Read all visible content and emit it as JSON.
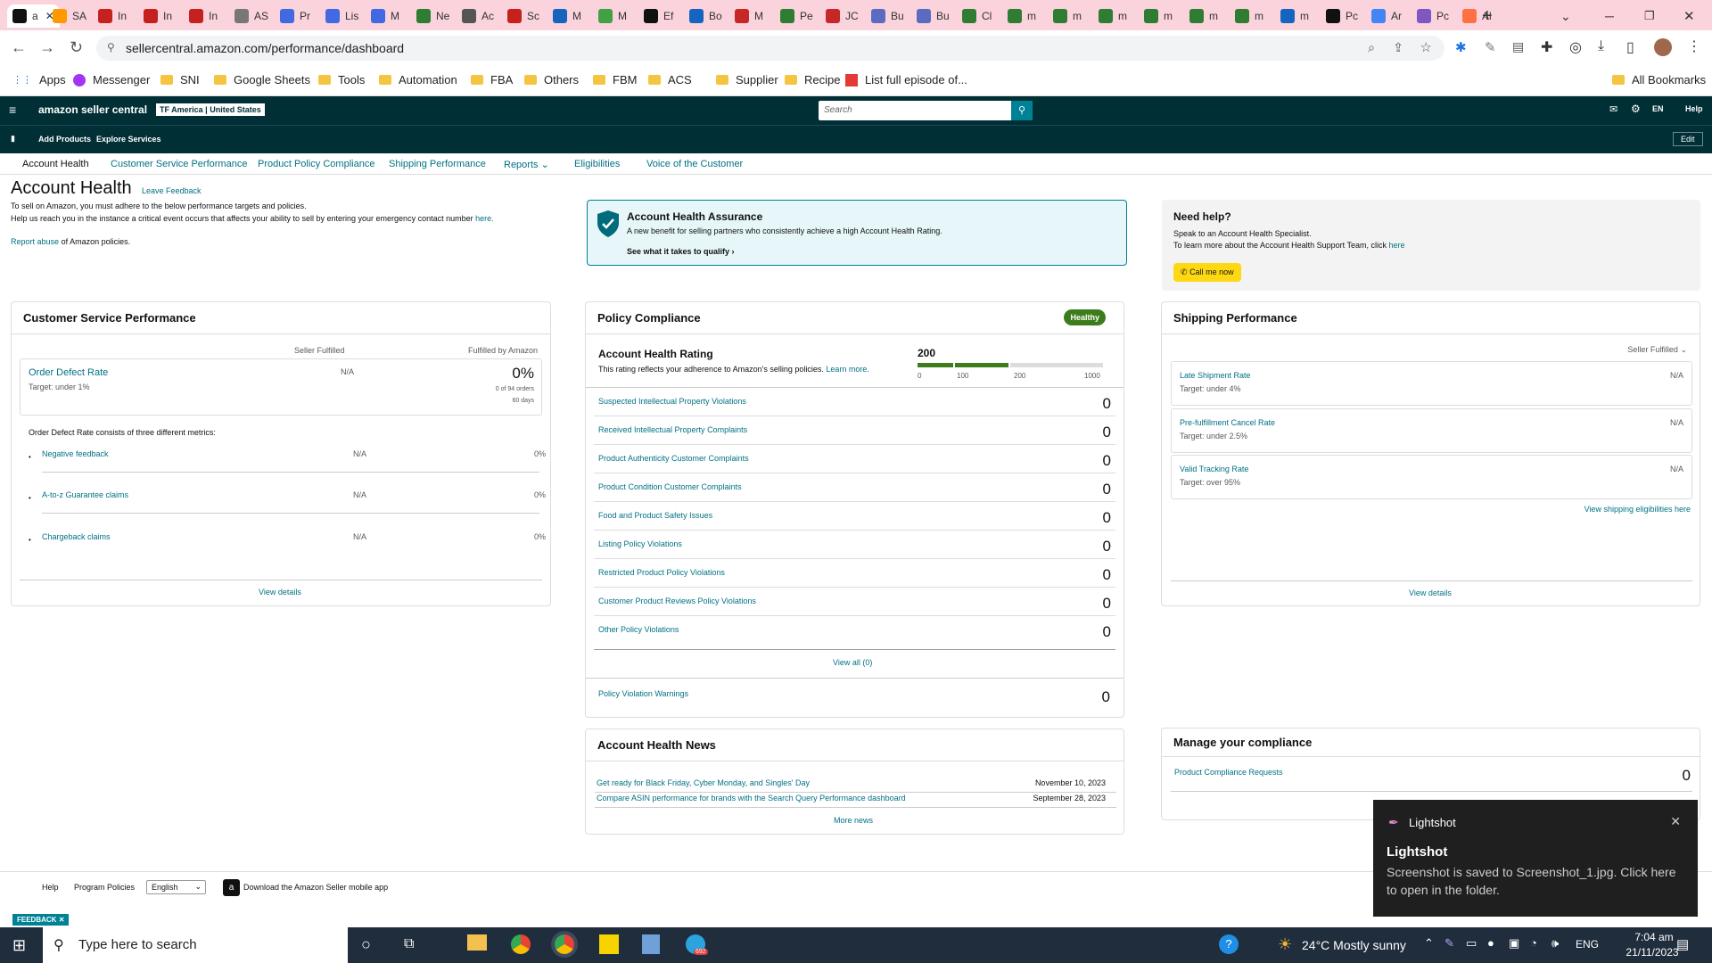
{
  "browser": {
    "tabs": [
      {
        "label": "a",
        "active": true
      },
      {
        "label": "SA"
      },
      {
        "label": "In"
      },
      {
        "label": "In"
      },
      {
        "label": "In"
      },
      {
        "label": "AS"
      },
      {
        "label": "Pr"
      },
      {
        "label": "Lis"
      },
      {
        "label": "M"
      },
      {
        "label": "Ne"
      },
      {
        "label": "Ac"
      },
      {
        "label": "Sc"
      },
      {
        "label": "M"
      },
      {
        "label": "M"
      },
      {
        "label": "Ef"
      },
      {
        "label": "Bo"
      },
      {
        "label": "M"
      },
      {
        "label": "Pe"
      },
      {
        "label": "JC"
      },
      {
        "label": "Bu"
      },
      {
        "label": "Bu"
      },
      {
        "label": "Cl"
      },
      {
        "label": "m"
      },
      {
        "label": "m"
      },
      {
        "label": "m"
      },
      {
        "label": "m"
      },
      {
        "label": "m"
      },
      {
        "label": "m"
      },
      {
        "label": "m"
      },
      {
        "label": "Pc"
      },
      {
        "label": "Ar"
      },
      {
        "label": "Pc"
      },
      {
        "label": "Al"
      }
    ],
    "url": "sellercentral.amazon.com/performance/dashboard",
    "bookmarks": [
      "Apps",
      "Messenger",
      "SNI",
      "Google Sheets",
      "Tools",
      "Automation",
      "FBA",
      "Others",
      "FBM",
      "ACS",
      "Supplier",
      "Recipe",
      "List full episode of..."
    ],
    "all_bookmarks": "All Bookmarks"
  },
  "header": {
    "logo": "amazon seller central",
    "account": "TF America | United States",
    "search_placeholder": "Search",
    "lang": "EN",
    "help": "Help",
    "add_products": "Add Products",
    "explore_services": "Explore Services",
    "edit": "Edit"
  },
  "nav": [
    "Account Health",
    "Customer Service Performance",
    "Product Policy Compliance",
    "Shipping Performance",
    "Reports",
    "Eligibilities",
    "Voice of the Customer"
  ],
  "intro": {
    "title": "Account Health",
    "leave_feedback": "Leave Feedback",
    "line1": "To sell on Amazon, you must adhere to the below performance targets and policies.",
    "line2": "Help us reach you in the instance a critical event occurs that affects your ability to sell by entering your emergency contact number",
    "here": "here.",
    "report_abuse": "Report abuse",
    "report_suffix": "of Amazon policies."
  },
  "assurance": {
    "title": "Account Health Assurance",
    "desc": "A new benefit for selling partners who consistently achieve a high Account Health Rating.",
    "link": "See what it takes to qualify"
  },
  "need_help": {
    "title": "Need help?",
    "line1": "Speak to an Account Health Specialist.",
    "line2": "To learn more about the Account Health Support Team, click",
    "here": "here",
    "button": "Call me now"
  },
  "csp": {
    "title": "Customer Service Performance",
    "col_sf": "Seller Fulfilled",
    "col_fba": "Fulfilled by Amazon",
    "odr_label": "Order Defect Rate",
    "odr_target": "Target: under 1%",
    "odr_sf": "N/A",
    "odr_fba": "0%",
    "odr_orders": "0 of 94 orders",
    "odr_days": "60 days",
    "consists": "Order Defect Rate consists of three different metrics:",
    "metrics": [
      {
        "name": "Negative feedback",
        "sf": "N/A",
        "fba": "0%"
      },
      {
        "name": "A-to-z Guarantee claims",
        "sf": "N/A",
        "fba": "0%"
      },
      {
        "name": "Chargeback claims",
        "sf": "N/A",
        "fba": "0%"
      }
    ],
    "view_details": "View details"
  },
  "policy": {
    "title": "Policy Compliance",
    "badge": "Healthy",
    "ahr_title": "Account Health Rating",
    "ahr_desc": "This rating reflects your adherence to Amazon's selling policies.",
    "learn_more": "Learn more.",
    "rating": "200",
    "rating_value": 200,
    "scale": [
      "0",
      "100",
      "200",
      "1000"
    ],
    "items": [
      {
        "name": "Suspected Intellectual Property Violations",
        "count": "0"
      },
      {
        "name": "Received Intellectual Property Complaints",
        "count": "0"
      },
      {
        "name": "Product Authenticity Customer Complaints",
        "count": "0"
      },
      {
        "name": "Product Condition Customer Complaints",
        "count": "0"
      },
      {
        "name": "Food and Product Safety Issues",
        "count": "0"
      },
      {
        "name": "Listing Policy Violations",
        "count": "0"
      },
      {
        "name": "Restricted Product Policy Violations",
        "count": "0"
      },
      {
        "name": "Customer Product Reviews Policy Violations",
        "count": "0"
      },
      {
        "name": "Other Policy Violations",
        "count": "0"
      }
    ],
    "view_all": "View all (0)",
    "warnings": "Policy Violation Warnings",
    "warnings_count": "0"
  },
  "news": {
    "title": "Account Health News",
    "items": [
      {
        "text": "Get ready for Black Friday, Cyber Monday, and Singles' Day",
        "date": "November 10, 2023"
      },
      {
        "text": "Compare ASIN performance for brands with the Search Query Performance dashboard",
        "date": "September 28, 2023"
      }
    ],
    "more": "More news"
  },
  "shipping": {
    "title": "Shipping Performance",
    "filter": "Seller Fulfilled",
    "metrics": [
      {
        "name": "Late Shipment Rate",
        "target": "Target: under 4%",
        "value": "N/A"
      },
      {
        "name": "Pre-fulfillment Cancel Rate",
        "target": "Target: under 2.5%",
        "value": "N/A"
      },
      {
        "name": "Valid Tracking Rate",
        "target": "Target: over 95%",
        "value": "N/A"
      }
    ],
    "eligibility": "View shipping eligibilities here",
    "view_details": "View details"
  },
  "compliance": {
    "title": "Manage your compliance",
    "item": "Product Compliance Requests",
    "count": "0"
  },
  "footer": {
    "help": "Help",
    "policies": "Program Policies",
    "language": "English",
    "app": "Download the Amazon Seller mobile app",
    "feedback": "FEEDBACK"
  },
  "toast": {
    "app": "Lightshot",
    "title": "Lightshot",
    "message": "Screenshot is saved to Screenshot_1.jpg. Click here to open in the folder."
  },
  "taskbar": {
    "search": "Type here to search",
    "weather": "24°C  Mostly sunny",
    "lang": "ENG",
    "time": "7:04 am",
    "date": "21/11/2023",
    "badge": "692"
  }
}
